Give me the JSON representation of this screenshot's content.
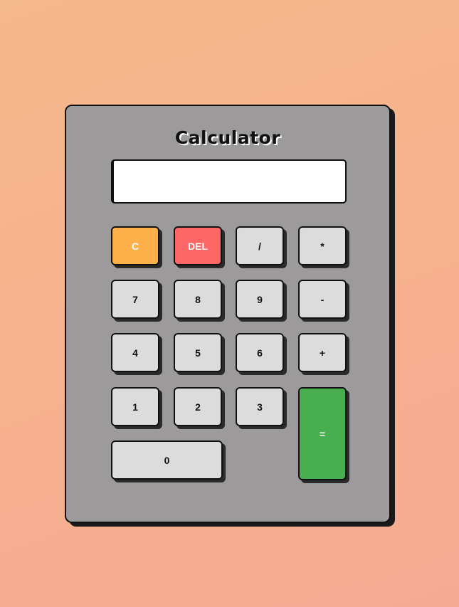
{
  "calculator": {
    "title": "Calculator",
    "display_value": "",
    "keys": {
      "clear": "C",
      "del": "DEL",
      "divide": "/",
      "multiply": "*",
      "seven": "7",
      "eight": "8",
      "nine": "9",
      "minus": "-",
      "four": "4",
      "five": "5",
      "six": "6",
      "plus": "+",
      "one": "1",
      "two": "2",
      "three": "3",
      "equals": "=",
      "zero": "0"
    }
  },
  "colors": {
    "clear_key": "#fdb04a",
    "del_key": "#fe6766",
    "equals_key": "#49ae50",
    "number_key": "#dcdcdc",
    "body": "#9c9a9b"
  }
}
